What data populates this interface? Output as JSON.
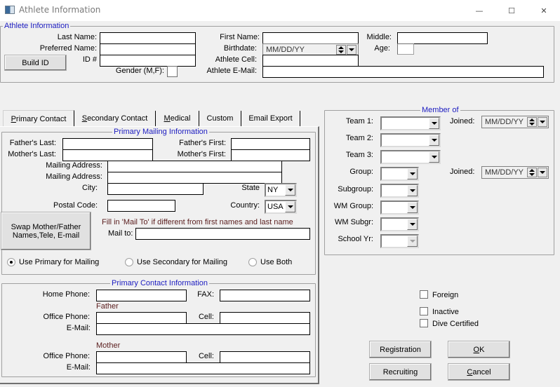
{
  "window": {
    "title": "Athlete Information",
    "minimize": "—",
    "maximize": "☐",
    "close": "✕"
  },
  "athlete": {
    "group_title": "Athlete Information",
    "last_name_label": "Last Name:",
    "last_name": "",
    "preferred_name_label": "Preferred Name:",
    "preferred_name": "",
    "id_label": "ID #",
    "id": "",
    "build_id_button": "Build ID",
    "gender_label": "Gender (M,F):",
    "gender": "",
    "first_name_label": "First Name:",
    "first_name": "",
    "birthdate_label": "Birthdate:",
    "birthdate": "MM/DD/YY",
    "cell_label": "Athlete Cell:",
    "cell": "",
    "email_label": "Athlete E-Mail:",
    "email": "",
    "middle_label": "Middle:",
    "middle": "",
    "age_label": "Age:",
    "age": ""
  },
  "tabs": [
    {
      "label": "Primary Contact",
      "accel": "P",
      "rest": "rimary Contact",
      "active": true
    },
    {
      "label": "Secondary Contact",
      "accel": "S",
      "rest": "econdary Contact",
      "active": false
    },
    {
      "label": "Medical",
      "accel": "M",
      "rest": "edical",
      "active": false
    },
    {
      "label": "Custom",
      "accel": "",
      "rest": "Custom",
      "active": false
    },
    {
      "label": "Email Export",
      "accel": "",
      "rest": "Email Export",
      "active": false
    }
  ],
  "mailing": {
    "group_title": "Primary Mailing Information",
    "fathers_last_label": "Father's Last:",
    "fathers_last": "",
    "mothers_last_label": "Mother's Last:",
    "mothers_last": "",
    "fathers_first_label": "Father's First:",
    "fathers_first": "",
    "mothers_first_label": "Mother's First:",
    "mothers_first": "",
    "address1_label": "Mailing Address:",
    "address1": "",
    "address2_label": "Mailing Address:",
    "address2": "",
    "city_label": "City:",
    "city": "",
    "state_label": "State",
    "state": "NY",
    "postal_label": "Postal Code:",
    "postal": "",
    "country_label": "Country:",
    "country": "USA",
    "swap_button_line1": "Swap Mother/Father",
    "swap_button_line2": "Names,Tele, E-mail",
    "mailto_hint": "Fill in 'Mail To' if different from first names and last name",
    "mailto_label": "Mail to:",
    "mailto": "",
    "radio_primary": "Use Primary for Mailing",
    "radio_secondary": "Use Secondary for Mailing",
    "radio_both": "Use Both",
    "selected": "primary"
  },
  "contact": {
    "group_title": "Primary Contact Information",
    "home_phone_label": "Home Phone:",
    "home_phone": "",
    "fax_label": "FAX:",
    "fax": "",
    "father_heading": "Father",
    "father_office_label": "Office Phone:",
    "father_office": "",
    "father_cell_label": "Cell:",
    "father_cell": "",
    "father_email_label": "E-Mail:",
    "father_email": "",
    "mother_heading": "Mother",
    "mother_office_label": "Office Phone:",
    "mother_office": "",
    "mother_cell_label": "Cell:",
    "mother_cell": "",
    "mother_email_label": "E-Mail:",
    "mother_email": ""
  },
  "member_of": {
    "group_title": "Member of",
    "team1_label": "Team 1:",
    "team2_label": "Team 2:",
    "team3_label": "Team 3:",
    "group_label": "Group:",
    "subgroup_label": "Subgroup:",
    "wm_group_label": "WM Group:",
    "wm_subgr_label": "WM Subgr:",
    "school_yr_label": "School Yr:",
    "joined_label": "Joined:",
    "joined1": "MM/DD/YY",
    "joined2": "MM/DD/YY"
  },
  "flags": {
    "foreign": "Foreign",
    "inactive": "Inactive",
    "dive_certified": "Dive Certified"
  },
  "buttons": {
    "registration": "Registration",
    "recruiting": "Recruiting",
    "ok_accel": "O",
    "ok_rest": "K",
    "cancel_accel": "C",
    "cancel_rest": "ancel"
  }
}
